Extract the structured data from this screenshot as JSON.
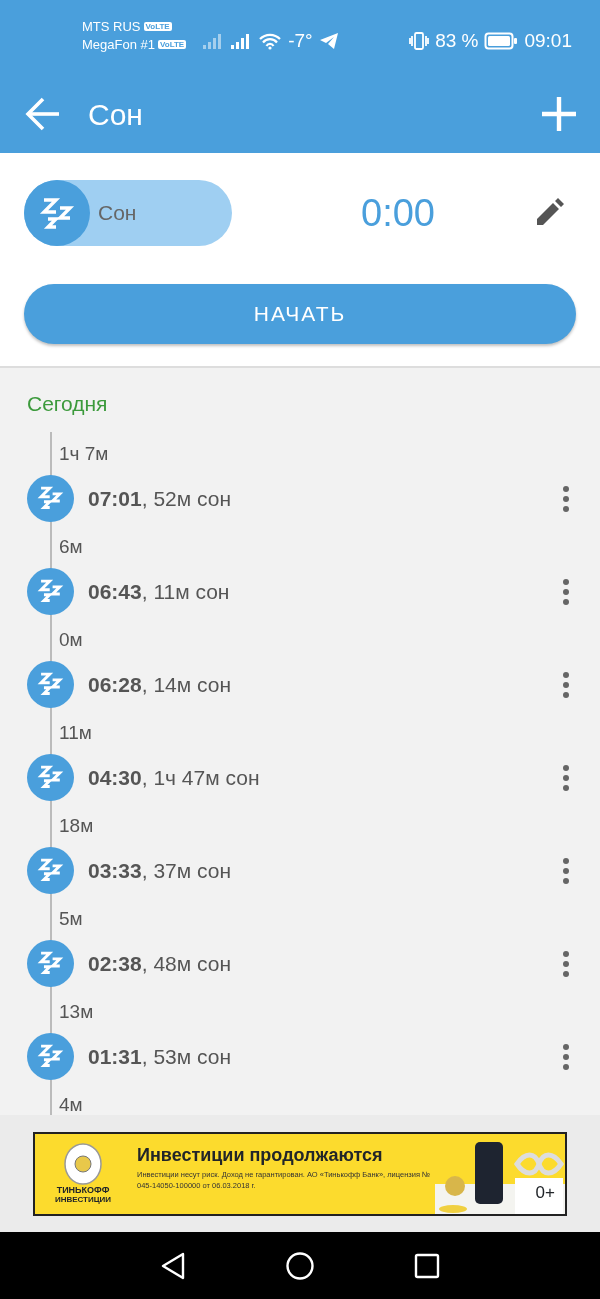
{
  "status_bar": {
    "carriers": [
      {
        "name": "MTS RUS",
        "badge": "VoLTE"
      },
      {
        "name": "MegaFon #1",
        "badge": "VoLTE"
      }
    ],
    "temperature": "-7°",
    "battery": "83 %",
    "time": "09:01"
  },
  "app_bar": {
    "title": "Сон"
  },
  "activity": {
    "label": "Сон",
    "timer": "0:00",
    "start_button": "НАЧАТЬ"
  },
  "section": "Сегодня",
  "timeline": [
    {
      "kind": "gap",
      "text": "1ч 7м"
    },
    {
      "kind": "entry",
      "text": "**07:01**, 52м сон"
    },
    {
      "kind": "gap",
      "text": "6м"
    },
    {
      "kind": "entry",
      "text": "**06:43**, 11м сон"
    },
    {
      "kind": "gap",
      "text": "0м"
    },
    {
      "kind": "entry",
      "text": "**06:28**, 14м сон"
    },
    {
      "kind": "gap",
      "text": "11м"
    },
    {
      "kind": "entry",
      "text": "**04:30**, 1ч 47м сон"
    },
    {
      "kind": "gap",
      "text": "18м"
    },
    {
      "kind": "entry",
      "text": "**03:33**, 37м сон"
    },
    {
      "kind": "gap",
      "text": "5м"
    },
    {
      "kind": "entry",
      "text": "**02:38**, 48м сон"
    },
    {
      "kind": "gap",
      "text": "13м"
    },
    {
      "kind": "entry",
      "text": "**01:31**, 53м сон"
    },
    {
      "kind": "gap",
      "text": "4м"
    }
  ],
  "ad": {
    "brand": "ТИНЬКОФФ",
    "brand_sub": "ИНВЕСТИЦИИ",
    "headline": "Инвестиции продолжаются",
    "disclaimer": "Инвестиции несут риск. Доход не гарантирован. АО «Тинькофф Банк», лицензия № 045-14050-100000 от 06.03.2018 г.",
    "age": "0+"
  }
}
